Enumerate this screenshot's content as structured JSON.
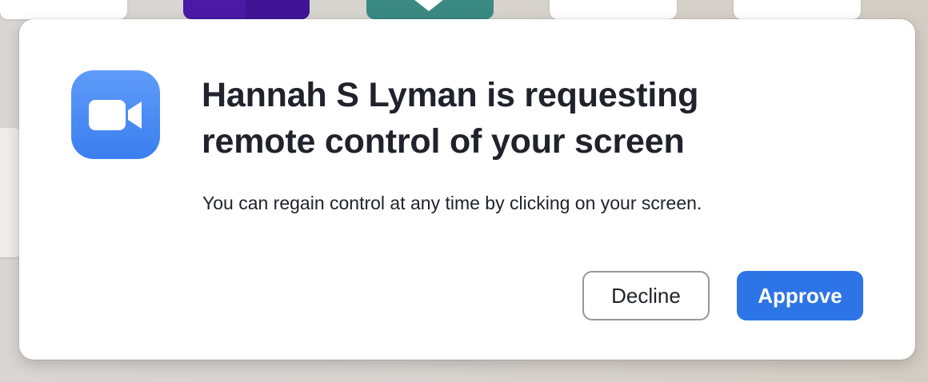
{
  "dialog": {
    "title": "Hannah S Lyman is requesting remote control of your screen",
    "message": "You can regain control at any time by clicking on your screen.",
    "decline_label": "Decline",
    "approve_label": "Approve",
    "app_icon": "zoom-video-camera-icon"
  },
  "colors": {
    "accent": "#2d75e6",
    "icon_gradient_top": "#5f9bf9",
    "icon_gradient_bottom": "#3a7fef",
    "text": "#22222d"
  }
}
